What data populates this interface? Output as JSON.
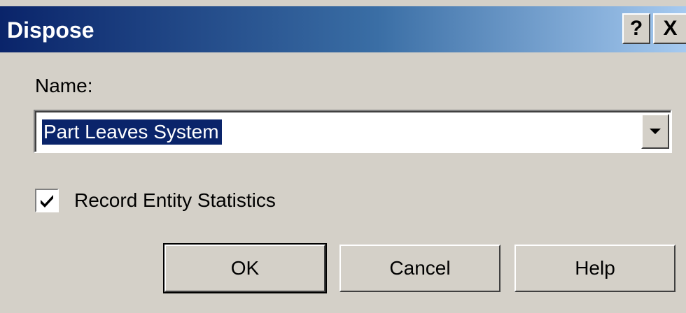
{
  "window": {
    "title": "Dispose",
    "help_button": "?",
    "close_button": "X"
  },
  "form": {
    "name_label": "Name:",
    "name_value": "Part Leaves System",
    "record_stats_label": "Record Entity Statistics",
    "record_stats_checked": true
  },
  "buttons": {
    "ok": "OK",
    "cancel": "Cancel",
    "help": "Help"
  },
  "colors": {
    "titlebar_start": "#0a246a",
    "titlebar_end": "#a6caf0",
    "dialog_bg": "#d4d0c8",
    "selection": "#0a246a"
  }
}
